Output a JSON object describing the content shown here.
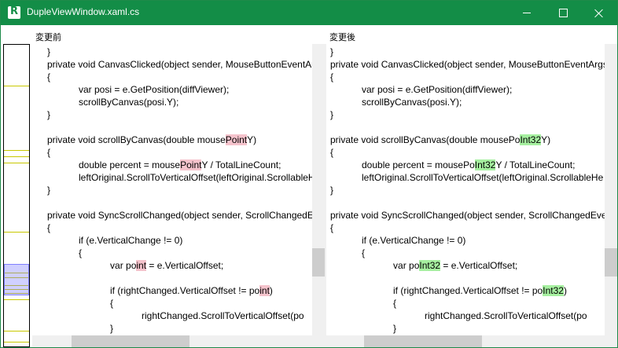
{
  "window": {
    "title": "DupleViewWindow.xaml.cs",
    "accent_color": "#138d47"
  },
  "icons": {
    "app": "app-icon",
    "minimize": "minimize-icon",
    "maximize": "maximize-icon",
    "close": "close-icon"
  },
  "left_pane": {
    "label": "変更前",
    "lines": [
      {
        "segments": [
          {
            "text": "}",
            "hl": ""
          }
        ]
      },
      {
        "segments": [
          {
            "text": "private void CanvasClicked(object sender, MouseButtonEventArgs",
            "hl": ""
          }
        ]
      },
      {
        "segments": [
          {
            "text": "{",
            "hl": ""
          }
        ]
      },
      {
        "segments": [
          {
            "text": "            var posi = e.GetPosition(diffViewer);",
            "hl": ""
          }
        ]
      },
      {
        "segments": [
          {
            "text": "            scrollByCanvas(posi.Y);",
            "hl": ""
          }
        ]
      },
      {
        "segments": [
          {
            "text": "}",
            "hl": ""
          }
        ]
      },
      {
        "segments": [
          {
            "text": "",
            "hl": ""
          }
        ]
      },
      {
        "segments": [
          {
            "text": "private void scrollByCanvas(double mouse",
            "hl": ""
          },
          {
            "text": "Point",
            "hl": "del"
          },
          {
            "text": "Y)",
            "hl": ""
          }
        ]
      },
      {
        "segments": [
          {
            "text": "{",
            "hl": ""
          }
        ]
      },
      {
        "segments": [
          {
            "text": "            double percent = mouse",
            "hl": ""
          },
          {
            "text": "Point",
            "hl": "del"
          },
          {
            "text": "Y / TotalLineCount;",
            "hl": ""
          }
        ]
      },
      {
        "segments": [
          {
            "text": "            leftOriginal.ScrollToVerticalOffset(leftOriginal.ScrollableHe",
            "hl": ""
          }
        ]
      },
      {
        "segments": [
          {
            "text": "}",
            "hl": ""
          }
        ]
      },
      {
        "segments": [
          {
            "text": "",
            "hl": ""
          }
        ]
      },
      {
        "segments": [
          {
            "text": "private void SyncScrollChanged(object sender, ScrollChangedEven",
            "hl": ""
          }
        ]
      },
      {
        "segments": [
          {
            "text": "{",
            "hl": ""
          }
        ]
      },
      {
        "segments": [
          {
            "text": "            if (e.VerticalChange != 0)",
            "hl": ""
          }
        ]
      },
      {
        "segments": [
          {
            "text": "            {",
            "hl": ""
          }
        ]
      },
      {
        "segments": [
          {
            "text": "                        var po",
            "hl": ""
          },
          {
            "text": "int",
            "hl": "del"
          },
          {
            "text": " = e.VerticalOffset;",
            "hl": ""
          }
        ]
      },
      {
        "segments": [
          {
            "text": "",
            "hl": ""
          }
        ]
      },
      {
        "segments": [
          {
            "text": "                        if (rightChanged.VerticalOffset != po",
            "hl": ""
          },
          {
            "text": "int",
            "hl": "del"
          },
          {
            "text": ")",
            "hl": ""
          }
        ]
      },
      {
        "segments": [
          {
            "text": "                        {",
            "hl": ""
          }
        ]
      },
      {
        "segments": [
          {
            "text": "                                    rightChanged.ScrollToVerticalOffset(po",
            "hl": ""
          }
        ]
      },
      {
        "segments": [
          {
            "text": "                        }",
            "hl": ""
          }
        ]
      }
    ]
  },
  "right_pane": {
    "label": "変更後",
    "lines": [
      {
        "segments": [
          {
            "text": "}",
            "hl": ""
          }
        ]
      },
      {
        "segments": [
          {
            "text": "private void CanvasClicked(object sender, MouseButtonEventArgs",
            "hl": ""
          }
        ]
      },
      {
        "segments": [
          {
            "text": "{",
            "hl": ""
          }
        ]
      },
      {
        "segments": [
          {
            "text": "            var posi = e.GetPosition(diffViewer);",
            "hl": ""
          }
        ]
      },
      {
        "segments": [
          {
            "text": "            scrollByCanvas(posi.Y);",
            "hl": ""
          }
        ]
      },
      {
        "segments": [
          {
            "text": "}",
            "hl": ""
          }
        ]
      },
      {
        "segments": [
          {
            "text": "",
            "hl": ""
          }
        ]
      },
      {
        "segments": [
          {
            "text": "private void scrollByCanvas(double mousePo",
            "hl": ""
          },
          {
            "text": "Int32",
            "hl": "add"
          },
          {
            "text": "Y)",
            "hl": ""
          }
        ]
      },
      {
        "segments": [
          {
            "text": "{",
            "hl": ""
          }
        ]
      },
      {
        "segments": [
          {
            "text": "            double percent = mousePo",
            "hl": ""
          },
          {
            "text": "Int32",
            "hl": "add"
          },
          {
            "text": "Y / TotalLineCount;",
            "hl": ""
          }
        ]
      },
      {
        "segments": [
          {
            "text": "            leftOriginal.ScrollToVerticalOffset(leftOriginal.ScrollableHe",
            "hl": ""
          }
        ]
      },
      {
        "segments": [
          {
            "text": "}",
            "hl": ""
          }
        ]
      },
      {
        "segments": [
          {
            "text": "",
            "hl": ""
          }
        ]
      },
      {
        "segments": [
          {
            "text": "private void SyncScrollChanged(object sender, ScrollChangedEven",
            "hl": ""
          }
        ]
      },
      {
        "segments": [
          {
            "text": "{",
            "hl": ""
          }
        ]
      },
      {
        "segments": [
          {
            "text": "            if (e.VerticalChange != 0)",
            "hl": ""
          }
        ]
      },
      {
        "segments": [
          {
            "text": "            {",
            "hl": ""
          }
        ]
      },
      {
        "segments": [
          {
            "text": "                        var po",
            "hl": ""
          },
          {
            "text": "Int32",
            "hl": "add"
          },
          {
            "text": " = e.VerticalOffset;",
            "hl": ""
          }
        ]
      },
      {
        "segments": [
          {
            "text": "",
            "hl": ""
          }
        ]
      },
      {
        "segments": [
          {
            "text": "                        if (rightChanged.VerticalOffset != po",
            "hl": ""
          },
          {
            "text": "Int32",
            "hl": "add"
          },
          {
            "text": ")",
            "hl": ""
          }
        ]
      },
      {
        "segments": [
          {
            "text": "                        {",
            "hl": ""
          }
        ]
      },
      {
        "segments": [
          {
            "text": "                                    rightChanged.ScrollToVerticalOffset(po",
            "hl": ""
          }
        ]
      },
      {
        "segments": [
          {
            "text": "                        }",
            "hl": ""
          }
        ]
      }
    ]
  },
  "colors": {
    "deleted_highlight": "#f5c3cc",
    "added_highlight": "#a6f0a0",
    "overview_marker": "#c8c800",
    "overview_viewport": "#8080ff"
  }
}
